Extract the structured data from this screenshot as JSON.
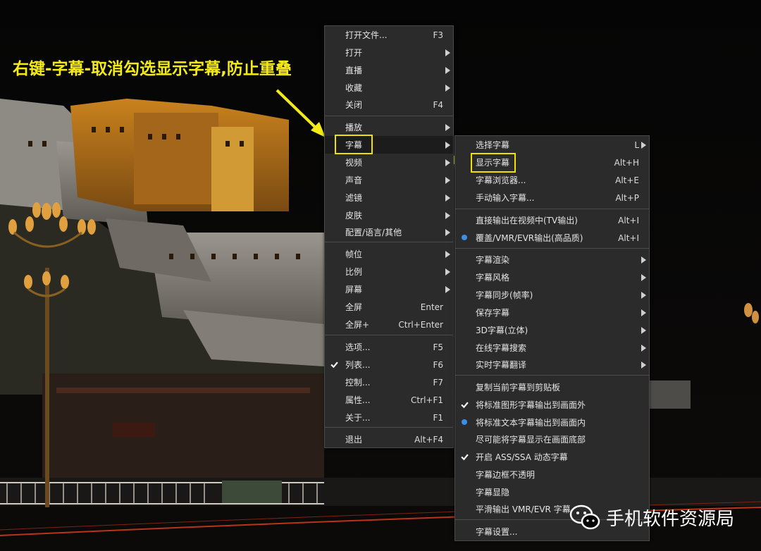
{
  "annotation": "右键-字幕-取消勾选显示字幕,防止重叠",
  "watermark": {
    "text": "手机软件资源局",
    "icon": "wechat-icon"
  },
  "colors": {
    "menu_bg": "#2b2b2b",
    "highlight": "#f0e000",
    "radio": "#3a8ee6"
  },
  "main_menu": {
    "items": [
      {
        "label": "打开文件...",
        "shortcut": "F3"
      },
      {
        "label": "打开",
        "submenu": true
      },
      {
        "label": "直播",
        "submenu": true
      },
      {
        "label": "收藏",
        "submenu": true
      },
      {
        "label": "关闭",
        "shortcut": "F4"
      },
      {
        "label": "播放",
        "submenu": true
      },
      {
        "label": "字幕",
        "submenu": true,
        "active": true
      },
      {
        "label": "视频",
        "submenu": true
      },
      {
        "label": "声音",
        "submenu": true
      },
      {
        "label": "滤镜",
        "submenu": true
      },
      {
        "label": "皮肤",
        "submenu": true
      },
      {
        "label": "配置/语言/其他",
        "submenu": true
      },
      {
        "label": "帧位",
        "submenu": true
      },
      {
        "label": "比例",
        "submenu": true
      },
      {
        "label": "屏幕",
        "submenu": true
      },
      {
        "label": "全屏",
        "shortcut": "Enter"
      },
      {
        "label": "全屏+",
        "shortcut": "Ctrl+Enter"
      },
      {
        "label": "选项...",
        "shortcut": "F5"
      },
      {
        "label": "列表...",
        "shortcut": "F6",
        "checked": true
      },
      {
        "label": "控制...",
        "shortcut": "F7"
      },
      {
        "label": "属性...",
        "shortcut": "Ctrl+F1"
      },
      {
        "label": "关于...",
        "shortcut": "F1"
      },
      {
        "label": "退出",
        "shortcut": "Alt+F4"
      }
    ]
  },
  "subtitle_menu": {
    "items": [
      {
        "label": "选择字幕",
        "shortcut": "L",
        "submenu": true
      },
      {
        "label": "显示字幕",
        "shortcut": "Alt+H",
        "highlighted": true
      },
      {
        "label": "字幕浏览器...",
        "shortcut": "Alt+E"
      },
      {
        "label": "手动输入字幕...",
        "shortcut": "Alt+P"
      },
      {
        "label": "直接输出在视频中(TV输出)",
        "shortcut": "Alt+I"
      },
      {
        "label": "覆盖/VMR/EVR输出(高品质)",
        "shortcut": "Alt+I",
        "radio": true
      },
      {
        "label": "字幕渲染",
        "submenu": true
      },
      {
        "label": "字幕风格",
        "submenu": true
      },
      {
        "label": "字幕同步(帧率)",
        "submenu": true
      },
      {
        "label": "保存字幕",
        "submenu": true
      },
      {
        "label": "3D字幕(立体)",
        "submenu": true
      },
      {
        "label": "在线字幕搜索",
        "submenu": true
      },
      {
        "label": "实时字幕翻译",
        "submenu": true
      },
      {
        "label": "复制当前字幕到剪贴板"
      },
      {
        "label": "将标准图形字幕输出到画面外",
        "checked": true
      },
      {
        "label": "将标准文本字幕输出到画面内",
        "radio": true
      },
      {
        "label": "尽可能将字幕显示在画面底部"
      },
      {
        "label": "开启 ASS/SSA 动态字幕",
        "checked": true
      },
      {
        "label": "字幕边框不透明"
      },
      {
        "label": "字幕显隐"
      },
      {
        "label": "平滑输出 VMR/EVR 字幕"
      },
      {
        "label": "字幕设置..."
      }
    ]
  }
}
